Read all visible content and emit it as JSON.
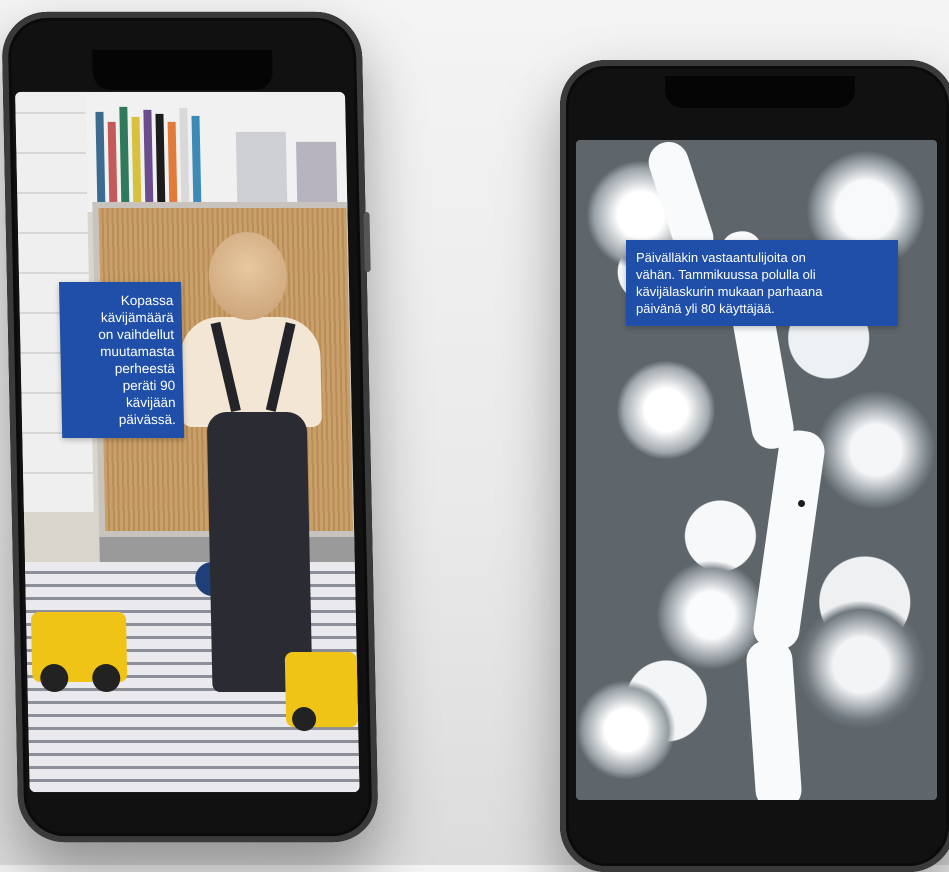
{
  "left_phone": {
    "overlay_lines": [
      "Kopassa",
      "kävijämäärä",
      "on vaihdellut",
      "muutamasta",
      "perheestä",
      "peräti 90",
      "kävijään",
      "päivässä."
    ]
  },
  "right_phone": {
    "overlay_lines": [
      "Päivälläkin vastaantulijoita on",
      "vähän. Tammikuussa polulla oli",
      "kävijälaskurin mukaan parhaana",
      "päivänä yli 80 käyttäjää."
    ]
  },
  "colors": {
    "overlay_bg": "#1f4fa8",
    "overlay_text": "#ffffff",
    "phone_body": "#111111"
  },
  "icons": {
    "left_phone_notch": "phone-notch",
    "right_phone_notch": "phone-notch"
  }
}
